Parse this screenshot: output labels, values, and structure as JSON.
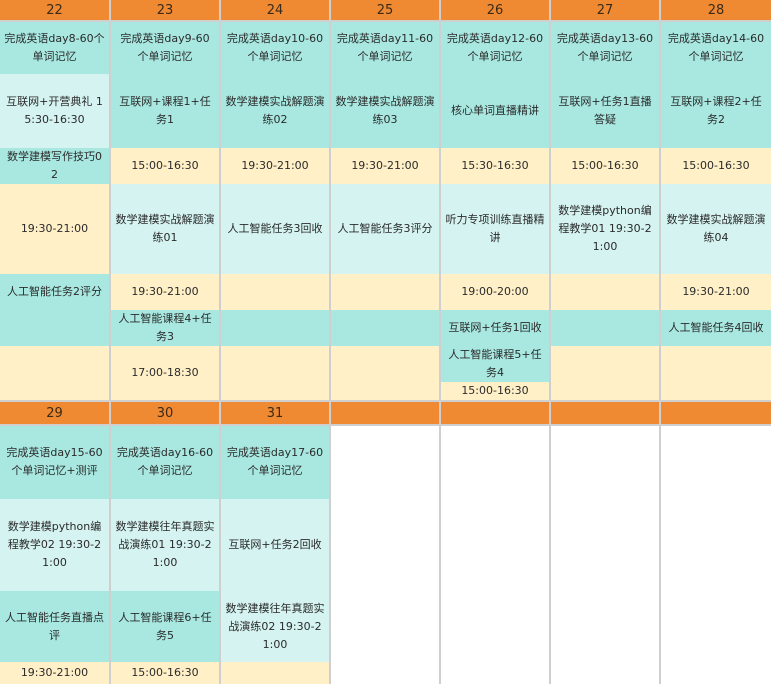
{
  "week1": {
    "days": [
      {
        "date": "22",
        "events": [
          {
            "text": "完成英语day8-60个单词记忆",
            "tone": "teal"
          },
          {
            "text": "互联网+开营典礼 15:30-16:30",
            "tone": "lteal"
          },
          {
            "text": "数学建模写作技巧02",
            "tone": "teal"
          },
          {
            "text": "19:30-21:00",
            "tone": "cream"
          },
          {
            "text": "人工智能任务2评分",
            "tone": "teal"
          },
          {
            "text": "",
            "tone": "teal"
          },
          {
            "text": "",
            "tone": "cream"
          }
        ]
      },
      {
        "date": "23",
        "events": [
          {
            "text": "完成英语day9-60个单词记忆",
            "tone": "teal"
          },
          {
            "text": "互联网+课程1+任务1",
            "tone": "teal"
          },
          {
            "text": "15:00-16:30",
            "tone": "cream"
          },
          {
            "text": "数学建模实战解题演练01",
            "tone": "lteal"
          },
          {
            "text": "19:30-21:00",
            "tone": "cream"
          },
          {
            "text": "人工智能课程4+任务3",
            "tone": "teal"
          },
          {
            "text": "17:00-18:30",
            "tone": "cream"
          }
        ]
      },
      {
        "date": "24",
        "events": [
          {
            "text": "完成英语day10-60个单词记忆",
            "tone": "teal"
          },
          {
            "text": "数学建模实战解题演练02",
            "tone": "teal"
          },
          {
            "text": "19:30-21:00",
            "tone": "cream"
          },
          {
            "text": "人工智能任务3回收",
            "tone": "lteal"
          },
          {
            "text": "",
            "tone": "cream"
          },
          {
            "text": "",
            "tone": "teal"
          },
          {
            "text": "",
            "tone": "cream"
          }
        ]
      },
      {
        "date": "25",
        "events": [
          {
            "text": "完成英语day11-60个单词记忆",
            "tone": "teal"
          },
          {
            "text": "数学建模实战解题演练03",
            "tone": "teal"
          },
          {
            "text": "19:30-21:00",
            "tone": "cream"
          },
          {
            "text": "人工智能任务3评分",
            "tone": "lteal"
          },
          {
            "text": "",
            "tone": "cream"
          },
          {
            "text": "",
            "tone": "teal"
          },
          {
            "text": "",
            "tone": "cream"
          }
        ]
      },
      {
        "date": "26",
        "events": [
          {
            "text": "完成英语day12-60个单词记忆",
            "tone": "teal"
          },
          {
            "text": "核心单词直播精讲",
            "tone": "teal"
          },
          {
            "text": "15:30-16:30",
            "tone": "cream"
          },
          {
            "text": "听力专项训练直播精讲",
            "tone": "lteal"
          },
          {
            "text": "19:00-20:00",
            "tone": "cream"
          },
          {
            "text": "互联网+任务1回收",
            "tone": "teal"
          },
          {
            "text": "人工智能课程5+任务4",
            "tone": "teal"
          },
          {
            "text": "15:00-16:30",
            "tone": "cream"
          }
        ]
      },
      {
        "date": "27",
        "events": [
          {
            "text": "完成英语day13-60个单词记忆",
            "tone": "teal"
          },
          {
            "text": "互联网+任务1直播答疑",
            "tone": "teal"
          },
          {
            "text": "15:00-16:30",
            "tone": "cream"
          },
          {
            "text": "数学建模python编程教学01 19:30-21:00",
            "tone": "lteal"
          },
          {
            "text": "",
            "tone": "cream"
          },
          {
            "text": "",
            "tone": "teal"
          },
          {
            "text": "",
            "tone": "cream"
          }
        ]
      },
      {
        "date": "28",
        "events": [
          {
            "text": "完成英语day14-60个单词记忆",
            "tone": "teal"
          },
          {
            "text": "互联网+课程2+任务2",
            "tone": "teal"
          },
          {
            "text": "15:00-16:30",
            "tone": "cream"
          },
          {
            "text": "数学建模实战解题演练04",
            "tone": "lteal"
          },
          {
            "text": "19:30-21:00",
            "tone": "cream"
          },
          {
            "text": "人工智能任务4回收",
            "tone": "teal"
          },
          {
            "text": "",
            "tone": "cream"
          }
        ]
      }
    ]
  },
  "week2": {
    "days": [
      {
        "date": "29",
        "events": [
          {
            "text": "完成英语day15-60个单词记忆+测评",
            "tone": "teal"
          },
          {
            "text": "数学建模python编程教学02 19:30-21:00",
            "tone": "lteal"
          },
          {
            "text": "人工智能任务直播点评",
            "tone": "teal"
          },
          {
            "text": "19:30-21:00",
            "tone": "cream"
          }
        ]
      },
      {
        "date": "30",
        "events": [
          {
            "text": "完成英语day16-60个单词记忆",
            "tone": "teal"
          },
          {
            "text": "数学建模往年真题实战演练01 19:30-21:00",
            "tone": "lteal"
          },
          {
            "text": "人工智能课程6+任务5",
            "tone": "teal"
          },
          {
            "text": "15:00-16:30",
            "tone": "cream"
          }
        ]
      },
      {
        "date": "31",
        "events": [
          {
            "text": "完成英语day17-60个单词记忆",
            "tone": "teal"
          },
          {
            "text": "互联网+任务2回收",
            "tone": "lteal"
          },
          {
            "text": "数学建模往年真题实战演练02 19:30-21:00",
            "tone": "lteal"
          },
          {
            "text": "",
            "tone": "cream"
          }
        ]
      },
      {
        "date": "",
        "events": []
      },
      {
        "date": "",
        "events": []
      },
      {
        "date": "",
        "events": []
      },
      {
        "date": "",
        "events": []
      }
    ]
  }
}
